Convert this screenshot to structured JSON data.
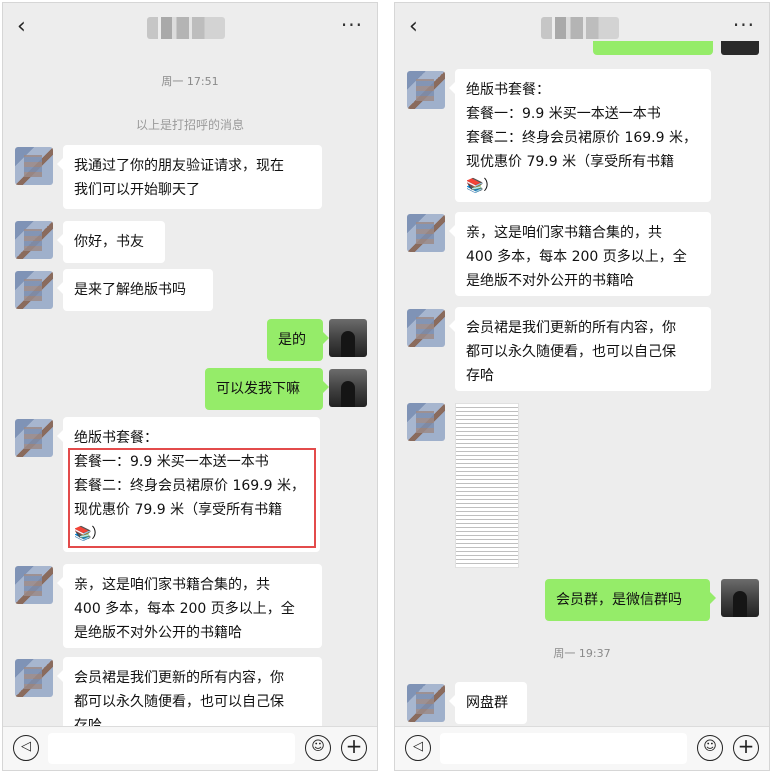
{
  "left": {
    "time": "周一 17:51",
    "system": "以上是打招呼的消息",
    "messages": [
      {
        "text": "我通过了你的朋友验证请求，现在\n我们可以开始聊天了"
      },
      {
        "text": "你好，书友"
      },
      {
        "text": "是来了解绝版书吗"
      },
      {
        "text": "是的"
      },
      {
        "text": "可以发我下嘛"
      },
      {
        "text": "绝版书套餐：\n套餐一：9.9 米买一本送一本书\n套餐二：终身会员裙原价 169.9 米，\n现优惠价 79.9 米（享受所有书籍\n📚）"
      },
      {
        "text": "亲，这是咱们家书籍合集的，共\n400 多本，每本 200 页多以上，全\n是绝版不对外公开的书籍哈"
      },
      {
        "text": "会员裙是我们更新的所有内容，你\n都可以永久随便看，也可以自己保\n存哈"
      }
    ]
  },
  "right": {
    "time": "周一 19:37",
    "messages": [
      {
        "text": "绝版书套餐：\n套餐一：9.9 米买一本送一本书\n套餐二：终身会员裙原价 169.9 米，\n现优惠价 79.9 米（享受所有书籍\n📚）"
      },
      {
        "text": "亲，这是咱们家书籍合集的，共\n400 多本，每本 200 页多以上，全\n是绝版不对外公开的书籍哈"
      },
      {
        "text": "会员裙是我们更新的所有内容，你\n都可以永久随便看，也可以自己保\n存哈"
      },
      {
        "text": "会员群，是微信群吗"
      },
      {
        "text": "网盘群"
      }
    ]
  },
  "icons": {
    "back": "‹",
    "more": "···",
    "voice": "◁))",
    "emoji": "☺",
    "plus": "+"
  },
  "colors": {
    "outgoing_bubble": "#95ec69",
    "incoming_bubble": "#ffffff",
    "background": "#ededed",
    "highlight": "#e34b4b"
  }
}
